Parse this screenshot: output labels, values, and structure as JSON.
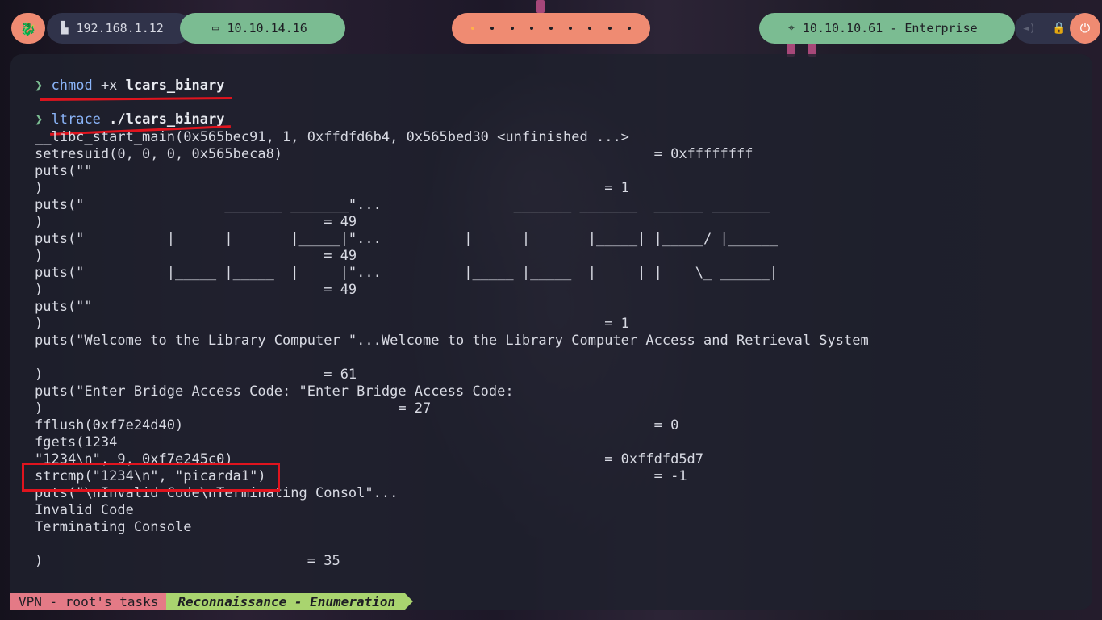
{
  "topbar": {
    "menu_icon": "kali-dragon-icon",
    "local_ip": "192.168.1.12",
    "vpn_ip": "10.10.14.16",
    "workspaces_count": 9,
    "target": "10.10.10.61 - Enterprise",
    "colors": {
      "accent_orange": "#ef8b72",
      "accent_green": "#7bbc92",
      "dark": "#30334a"
    }
  },
  "terminal": {
    "prompt_symbol": "❯",
    "cmd1": {
      "program": "chmod",
      "flag": "+x",
      "arg": "lcars_binary"
    },
    "cmd2": {
      "program": "ltrace",
      "arg": "./lcars_binary"
    },
    "lines": [
      "__libc_start_main(0x565bec91, 1, 0xffdfd6b4, 0x565bed30 <unfinished ...>",
      "setresuid(0, 0, 0, 0x565beca8)                                             = 0xffffffff",
      "puts(\"\"",
      ")                                                                    = 1",
      "puts(\"                 _______ _______\"...                _______ _______  ______ _______",
      ")                                  = 49",
      "puts(\"          |      |       |_____|\"...          |      |       |_____| |_____/ |______",
      ")                                  = 49",
      "puts(\"          |_____ |_____  |     |\"...          |_____ |_____  |     | |    \\_ ______|",
      ")                                  = 49",
      "puts(\"\"",
      ")                                                                    = 1",
      "puts(\"Welcome to the Library Computer \"...Welcome to the Library Computer Access and Retrieval System",
      "",
      ")                                  = 61",
      "puts(\"Enter Bridge Access Code: \"Enter Bridge Access Code:",
      ")                                           = 27",
      "fflush(0xf7e24d40)                                                         = 0",
      "fgets(1234",
      "\"1234\\n\", 9, 0xf7e245c0)                                             = 0xffdfd5d7",
      "strcmp(\"1234\\n\", \"picarda1\")                                               = -1",
      "puts(\"\\nInvalid Code\\nTerminating Consol\"...",
      "Invalid Code",
      "Terminating Console",
      "",
      ")                                = 35"
    ]
  },
  "statusbar": {
    "session": "VPN - root's tasks",
    "window": "Reconnaissance - Enumeration"
  }
}
